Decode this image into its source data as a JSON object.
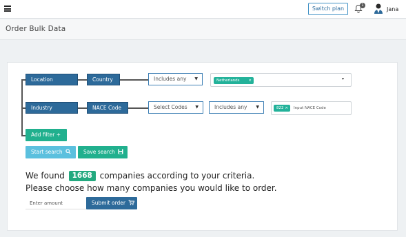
{
  "topbar": {
    "switch_plan_label": "Switch plan",
    "notification_count": "1",
    "username": "Jana"
  },
  "page": {
    "title": "Order Bulk Data"
  },
  "filters": {
    "row1": {
      "field": "Location",
      "subfield": "Country",
      "operator": "Includes any",
      "chip": "Netherlands"
    },
    "row2": {
      "field": "Industry",
      "subfield": "NACE Code",
      "selector": "Select Codes",
      "operator": "Includes any",
      "chip": "822",
      "input_hint": "Input NACE Code"
    }
  },
  "actions": {
    "add_filter_label": "Add filter +",
    "start_search_label": "Start search",
    "save_search_label": "Save search"
  },
  "result": {
    "prefix": "We found",
    "count": "1668",
    "suffix": "companies according to your criteria.",
    "prompt": "Please choose how many companies you would like to order."
  },
  "order": {
    "amount_placeholder": "Enter amount",
    "submit_label": "Submit order"
  },
  "colors": {
    "primary": "#2d6a9a",
    "accent_green": "#21b08e",
    "light_blue": "#5bc0de"
  }
}
